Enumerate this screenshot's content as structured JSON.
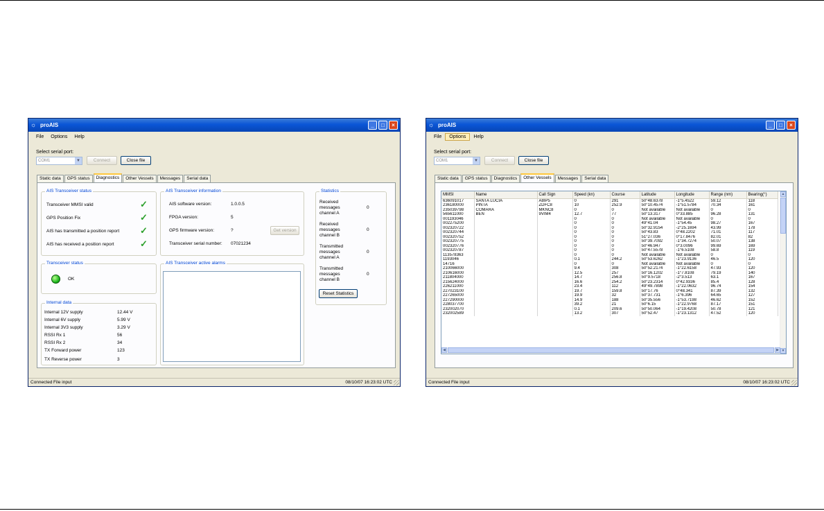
{
  "colors": {
    "titlebar": "#0a55d6",
    "window_bg": "#ece9d8",
    "group_title": "#0046d5",
    "check": "#2ca02c",
    "led": "#19b31a"
  },
  "window1": {
    "title": "proAIS",
    "menu": [
      "File",
      "Options",
      "Help"
    ],
    "serial_port_label": "Select serial port:",
    "serial_port_value": "COM1",
    "connect_label": "Connect",
    "close_file_label": "Close file",
    "tabs": [
      "Static data",
      "GPS status",
      "Diagnostics",
      "Other Vessels",
      "Messages",
      "Serial data"
    ],
    "active_tab": "Diagnostics",
    "transceiver_status": {
      "title": "AIS Transceiver status",
      "items": [
        "Transceiver MMSI valid",
        "GPS Position Fix",
        "AIS has transmitted a position report",
        "AIS has received a position report"
      ]
    },
    "transceiver_info": {
      "title": "AIS Transceiver information",
      "rows": [
        {
          "label": "AIS software version:",
          "value": "1.0.0.5"
        },
        {
          "label": "FPGA version:",
          "value": "5"
        },
        {
          "label": "GPS firmware version:",
          "value": "?"
        },
        {
          "label": "Transceiver serial number:",
          "value": "07021234"
        }
      ],
      "get_version_label": "Get version"
    },
    "statistics": {
      "title": "Statistics",
      "rows": [
        {
          "label": [
            "Received",
            "messages",
            "channel A"
          ],
          "value": "0"
        },
        {
          "label": [
            "Received",
            "messages",
            "channel B"
          ],
          "value": "0"
        },
        {
          "label": [
            "Transmitted",
            "messages",
            "channel A"
          ],
          "value": "0"
        },
        {
          "label": [
            "Transmitted",
            "messages",
            "channel B"
          ],
          "value": "0"
        }
      ],
      "reset_label": "Reset Statistics"
    },
    "transceiver_health": {
      "title": "Transceiver status",
      "state": "OK"
    },
    "alarms": {
      "title": "AIS Transceiver active alarms"
    },
    "internal_data": {
      "title": "Internal data",
      "rows": [
        {
          "label": "Internal 12V supply",
          "value": "12.44 V"
        },
        {
          "label": "Internal 6V supply",
          "value": "5.99 V"
        },
        {
          "label": "Internal 3V3 supply",
          "value": "3.29 V"
        },
        {
          "label": "RSSI Rx 1",
          "value": "56"
        },
        {
          "label": "RSSI Rx 2",
          "value": "34"
        },
        {
          "label": "TX Forward power",
          "value": "123"
        },
        {
          "label": "TX Reverse power",
          "value": "3"
        }
      ]
    },
    "status": {
      "connection": "Connected",
      "input": "File input",
      "datetime": "08/10/07 16:23:02 UTC"
    }
  },
  "window2": {
    "title": "proAIS",
    "menu": [
      "File",
      "Options",
      "Help"
    ],
    "active_menu": "Options",
    "serial_port_label": "Select serial port:",
    "serial_port_value": "COM1",
    "connect_label": "Connect",
    "close_file_label": "Close file",
    "tabs": [
      "Static data",
      "GPS status",
      "Diagnostics",
      "Other Vessels",
      "Messages",
      "Serial data"
    ],
    "active_tab": "Other Vessels",
    "columns": [
      "MMSI",
      "Name",
      "Call Sign",
      "Speed (kn)",
      "Course",
      "Latitude",
      "Longitude",
      "Range (nm)",
      "Bearing(°)"
    ],
    "rows": [
      [
        "636091017",
        "SANTA LUCIA",
        "A8IP5",
        "0",
        "291",
        "50°48.6378",
        "-1°5.4522",
        "59.12",
        "118"
      ],
      [
        "236180000",
        "PINTA",
        "ZDFC8",
        "10",
        "252.9",
        "50°10.4574",
        "-1°51.5784",
        "70.34",
        "161"
      ],
      [
        "235039798",
        "COMARA",
        "MKNC8",
        "0",
        "0",
        "Not available",
        "Not available",
        "0",
        "0"
      ],
      [
        "565611000",
        "BEN",
        "9VIM4",
        "12.7",
        "77",
        "50°13.317",
        "0°33.885",
        "96.28",
        "131"
      ],
      [
        "001193046",
        "",
        "",
        "0",
        "0",
        "Not available",
        "Not available",
        "0",
        "0"
      ],
      [
        "002275200",
        "",
        "",
        "0",
        "0",
        "49°41.04",
        "-1°54.45",
        "98.27",
        "167"
      ],
      [
        "002320722",
        "",
        "",
        "0",
        "0",
        "50°32.9154",
        "-2°25.1694",
        "43.99",
        "178"
      ],
      [
        "002320744",
        "",
        "",
        "0",
        "0",
        "50°43.83",
        "0°48.2202",
        "71.01",
        "117"
      ],
      [
        "002320752",
        "",
        "",
        "0",
        "0",
        "51°27.036",
        "0°17.8476",
        "82.01",
        "82"
      ],
      [
        "002320775",
        "",
        "",
        "0",
        "0",
        "50°39.7092",
        "-1°34.7274",
        "50.07",
        "138"
      ],
      [
        "002320776",
        "",
        "",
        "0",
        "0",
        "50°46.947",
        "0°3.0096",
        "99.69",
        "169"
      ],
      [
        "002320787",
        "",
        "",
        "0",
        "0",
        "50°47.5578",
        "-1°6.5108",
        "58.8",
        "119"
      ],
      [
        "113578363",
        "",
        "",
        "0",
        "0",
        "Not available",
        "Not available",
        "0",
        "0"
      ],
      [
        "1193046",
        "",
        "",
        "0.1",
        "244.2",
        "50°53.6262",
        "-1°23.9136",
        "46.5",
        "120"
      ],
      [
        "14716",
        "",
        "",
        "0",
        "0",
        "Not available",
        "Not available",
        "0",
        "0"
      ],
      [
        "210066000",
        "",
        "",
        "9.4",
        "308",
        "50°52.2174",
        "-1°22.6158",
        "47.93",
        "120"
      ],
      [
        "210616000",
        "",
        "",
        "12.5",
        "257",
        "50°16.1202",
        "-1°7.8108",
        "79.19",
        "140"
      ],
      [
        "211804000",
        "",
        "",
        "14.7",
        "256.8",
        "50°9.5718",
        "-2°3.513",
        "63.1",
        "167"
      ],
      [
        "215624000",
        "",
        "",
        "16.6",
        "254.2",
        "50°23.2314",
        "0°42.9336",
        "85.4",
        "128"
      ],
      [
        "226211000",
        "",
        "",
        "23.4",
        "112",
        "49°49.7898",
        "-1°22.0632",
        "96.74",
        "154"
      ],
      [
        "227023100",
        "",
        "",
        "19.7",
        "159.8",
        "50°17.76",
        "0°48.341",
        "87.39",
        "132"
      ],
      [
        "227265000",
        "",
        "",
        "19.9",
        "32",
        "50°37.731",
        "-1°6.396",
        "64.65",
        "127"
      ],
      [
        "227290000",
        "",
        "",
        "14.9",
        "188",
        "50°35.556",
        "-1°53.7198",
        "46.62",
        "152"
      ],
      [
        "228037700",
        "",
        "",
        "39.2",
        "21",
        "50°6.15",
        "-1°22.9768",
        "87.17",
        "151"
      ],
      [
        "232002070",
        "",
        "",
        "0.1",
        "209.6",
        "50°50.064",
        "-1°19.4208",
        "50.78",
        "121"
      ],
      [
        "232002589",
        "",
        "",
        "13.2",
        "307",
        "50°52.47",
        "-1°23.1312",
        "47.52",
        "120"
      ]
    ],
    "status": {
      "connection": "Connected",
      "input": "File input",
      "datetime": "08/10/07 16:23:02 UTC"
    }
  }
}
